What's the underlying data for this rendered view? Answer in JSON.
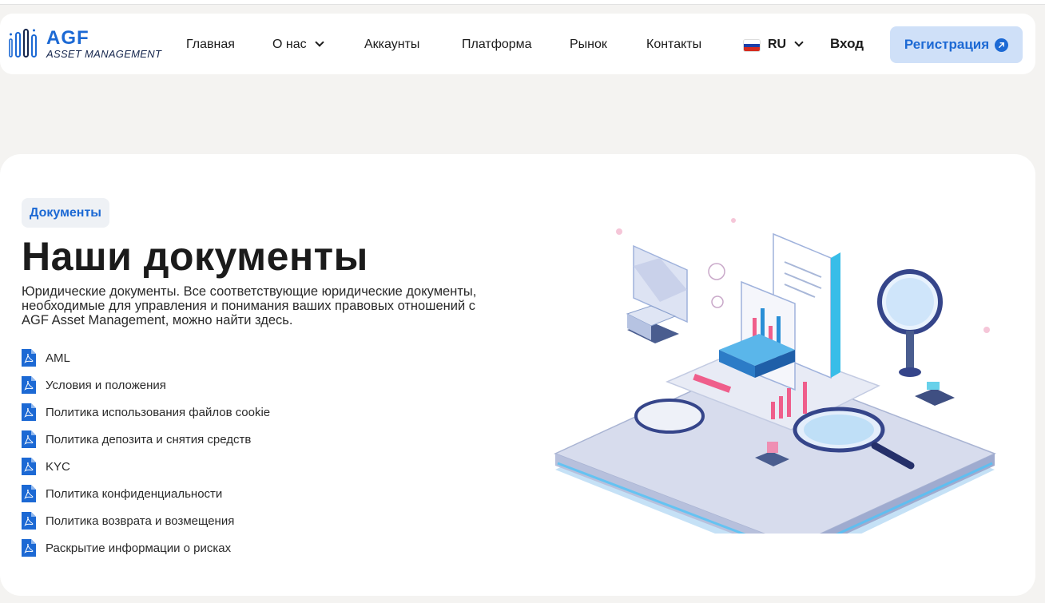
{
  "header": {
    "logo_main": "AGF",
    "logo_sub": "ASSET MANAGEMENT",
    "nav": [
      {
        "label": "Главная"
      },
      {
        "label": "О нас"
      },
      {
        "label": "Аккаунты"
      },
      {
        "label": "Платформа"
      },
      {
        "label": "Рынок"
      },
      {
        "label": "Контакты"
      }
    ],
    "language": "RU",
    "login_label": "Вход",
    "register_label": "Регистрация"
  },
  "main": {
    "badge": "Документы",
    "title": "Наши документы",
    "description": "Юридические документы. Все соответствующие юридические документы, необходимые для управления и понимания ваших правовых отношений с AGF Asset Management, можно найти здесь.",
    "documents": [
      {
        "label": "AML"
      },
      {
        "label": "Условия и положения"
      },
      {
        "label": "Политика использования файлов cookie"
      },
      {
        "label": "Политика депозита и снятия средств"
      },
      {
        "label": "KYC"
      },
      {
        "label": "Политика конфиденциальности"
      },
      {
        "label": "Политика возврата и возмещения"
      },
      {
        "label": "Раскрытие информации о рисках"
      }
    ]
  },
  "colors": {
    "accent": "#1c69d4",
    "register_bg": "#cfe0f8",
    "page_bg": "#f4f3f1"
  },
  "icons": {
    "document": "pdf-file-icon",
    "register": "arrow-up-right-icon",
    "dropdown": "chevron-down-icon",
    "language": "russia-flag-icon"
  }
}
